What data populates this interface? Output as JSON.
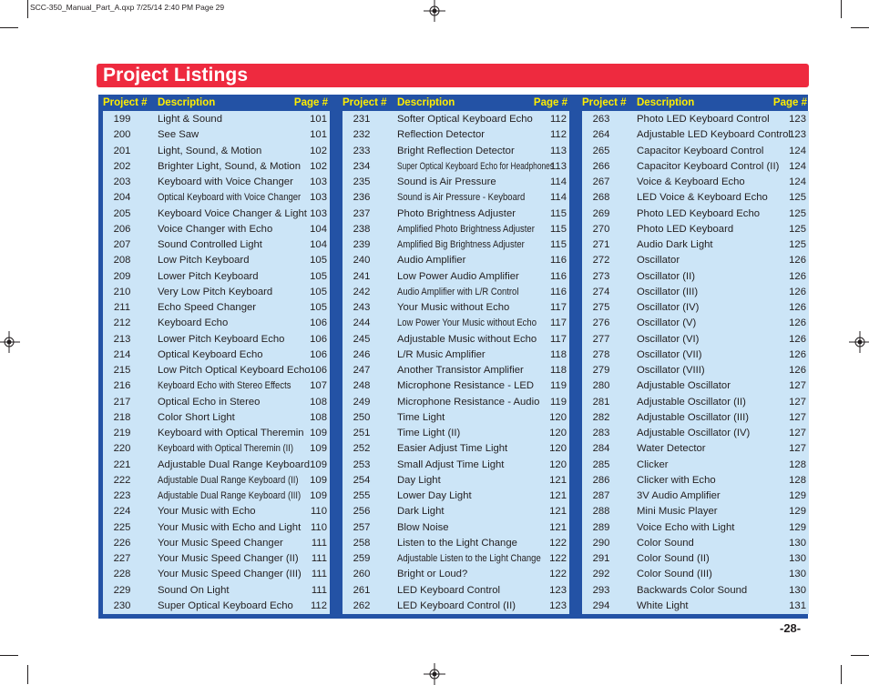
{
  "slug": "SCC-350_Manual_Part_A.qxp  7/25/14  2:40 PM  Page 29",
  "title": "Project Listings",
  "page_number": "-28-",
  "colors": {
    "banner": "#ee2a3f",
    "table_border": "#2352a5",
    "header_text": "#ffee00",
    "row_bg": "#cce5f7"
  },
  "headers": {
    "project": "Project #",
    "description": "Description",
    "page": "Page #"
  },
  "columns": [
    [
      {
        "num": "199",
        "desc": "Light & Sound",
        "page": "101"
      },
      {
        "num": "200",
        "desc": "See Saw",
        "page": "101"
      },
      {
        "num": "201",
        "desc": "Light, Sound, & Motion",
        "page": "102"
      },
      {
        "num": "202",
        "desc": "Brighter Light, Sound, & Motion",
        "page": "102"
      },
      {
        "num": "203",
        "desc": "Keyboard with Voice Changer",
        "page": "103"
      },
      {
        "num": "204",
        "desc": "Optical Keyboard with Voice Changer",
        "page": "103"
      },
      {
        "num": "205",
        "desc": "Keyboard Voice Changer & Light",
        "page": "103"
      },
      {
        "num": "206",
        "desc": "Voice Changer with Echo",
        "page": "104"
      },
      {
        "num": "207",
        "desc": "Sound Controlled Light",
        "page": "104"
      },
      {
        "num": "208",
        "desc": "Low Pitch Keyboard",
        "page": "105"
      },
      {
        "num": "209",
        "desc": "Lower Pitch Keyboard",
        "page": "105"
      },
      {
        "num": "210",
        "desc": "Very Low Pitch Keyboard",
        "page": "105"
      },
      {
        "num": "211",
        "desc": "Echo Speed Changer",
        "page": "105"
      },
      {
        "num": "212",
        "desc": "Keyboard Echo",
        "page": "106"
      },
      {
        "num": "213",
        "desc": "Lower Pitch Keyboard Echo",
        "page": "106"
      },
      {
        "num": "214",
        "desc": "Optical Keyboard Echo",
        "page": "106"
      },
      {
        "num": "215",
        "desc": "Low Pitch Optical Keyboard Echo",
        "page": "106"
      },
      {
        "num": "216",
        "desc": "Keyboard Echo with Stereo Effects",
        "page": "107"
      },
      {
        "num": "217",
        "desc": "Optical Echo in Stereo",
        "page": "108"
      },
      {
        "num": "218",
        "desc": "Color Short Light",
        "page": "108"
      },
      {
        "num": "219",
        "desc": "Keyboard with Optical Theremin",
        "page": "109"
      },
      {
        "num": "220",
        "desc": "Keyboard with Optical Theremin (II)",
        "page": "109"
      },
      {
        "num": "221",
        "desc": "Adjustable Dual Range Keyboard",
        "page": "109"
      },
      {
        "num": "222",
        "desc": "Adjustable Dual Range Keyboard (II)",
        "page": "109"
      },
      {
        "num": "223",
        "desc": "Adjustable Dual Range Keyboard (III)",
        "page": "109"
      },
      {
        "num": "224",
        "desc": "Your Music with Echo",
        "page": "110"
      },
      {
        "num": "225",
        "desc": "Your Music with Echo and Light",
        "page": "110"
      },
      {
        "num": "226",
        "desc": "Your Music Speed Changer",
        "page": "111"
      },
      {
        "num": "227",
        "desc": "Your Music Speed Changer (II)",
        "page": "111"
      },
      {
        "num": "228",
        "desc": "Your Music Speed Changer (III)",
        "page": "111"
      },
      {
        "num": "229",
        "desc": "Sound On Light",
        "page": "111"
      },
      {
        "num": "230",
        "desc": "Super Optical Keyboard Echo",
        "page": "112"
      }
    ],
    [
      {
        "num": "231",
        "desc": "Softer Optical Keyboard Echo",
        "page": "112"
      },
      {
        "num": "232",
        "desc": "Reflection Detector",
        "page": "112"
      },
      {
        "num": "233",
        "desc": "Bright Reflection Detector",
        "page": "113"
      },
      {
        "num": "234",
        "desc": "Super Optical Keyboard Echo for Headphones",
        "page": "113"
      },
      {
        "num": "235",
        "desc": "Sound is Air Pressure",
        "page": "114"
      },
      {
        "num": "236",
        "desc": "Sound is Air Pressure - Keyboard",
        "page": "114"
      },
      {
        "num": "237",
        "desc": "Photo Brightness Adjuster",
        "page": "115"
      },
      {
        "num": "238",
        "desc": "Amplified Photo Brightness Adjuster",
        "page": "115"
      },
      {
        "num": "239",
        "desc": "Amplified Big Brightness Adjuster",
        "page": "115"
      },
      {
        "num": "240",
        "desc": "Audio Amplifier",
        "page": "116"
      },
      {
        "num": "241",
        "desc": "Low Power Audio Amplifier",
        "page": "116"
      },
      {
        "num": "242",
        "desc": "Audio Amplifier with L/R Control",
        "page": "116"
      },
      {
        "num": "243",
        "desc": "Your Music without Echo",
        "page": "117"
      },
      {
        "num": "244",
        "desc": "Low Power Your Music without Echo",
        "page": "117"
      },
      {
        "num": "245",
        "desc": "Adjustable Music without Echo",
        "page": "117"
      },
      {
        "num": "246",
        "desc": "L/R Music Amplifier",
        "page": "118"
      },
      {
        "num": "247",
        "desc": "Another Transistor Amplifier",
        "page": "118"
      },
      {
        "num": "248",
        "desc": "Microphone Resistance - LED",
        "page": "119"
      },
      {
        "num": "249",
        "desc": "Microphone Resistance - Audio",
        "page": "119"
      },
      {
        "num": "250",
        "desc": "Time Light",
        "page": "120"
      },
      {
        "num": "251",
        "desc": "Time Light (II)",
        "page": "120"
      },
      {
        "num": "252",
        "desc": "Easier Adjust Time Light",
        "page": "120"
      },
      {
        "num": "253",
        "desc": "Small Adjust Time Light",
        "page": "120"
      },
      {
        "num": "254",
        "desc": "Day Light",
        "page": "121"
      },
      {
        "num": "255",
        "desc": "Lower Day Light",
        "page": "121"
      },
      {
        "num": "256",
        "desc": "Dark Light",
        "page": "121"
      },
      {
        "num": "257",
        "desc": "Blow Noise",
        "page": "121"
      },
      {
        "num": "258",
        "desc": "Listen to the Light Change",
        "page": "122"
      },
      {
        "num": "259",
        "desc": "Adjustable Listen to the Light Change",
        "page": "122"
      },
      {
        "num": "260",
        "desc": "Bright or Loud?",
        "page": "122"
      },
      {
        "num": "261",
        "desc": "LED Keyboard Control",
        "page": "123"
      },
      {
        "num": "262",
        "desc": "LED Keyboard Control (II)",
        "page": "123"
      }
    ],
    [
      {
        "num": "263",
        "desc": "Photo LED Keyboard Control",
        "page": "123"
      },
      {
        "num": "264",
        "desc": "Adjustable LED Keyboard Control",
        "page": "123"
      },
      {
        "num": "265",
        "desc": "Capacitor Keyboard Control",
        "page": "124"
      },
      {
        "num": "266",
        "desc": "Capacitor Keyboard Control (II)",
        "page": "124"
      },
      {
        "num": "267",
        "desc": "Voice & Keyboard Echo",
        "page": "124"
      },
      {
        "num": "268",
        "desc": "LED Voice & Keyboard Echo",
        "page": "125"
      },
      {
        "num": "269",
        "desc": "Photo LED Keyboard Echo",
        "page": "125"
      },
      {
        "num": "270",
        "desc": "Photo LED Keyboard",
        "page": "125"
      },
      {
        "num": "271",
        "desc": "Audio Dark Light",
        "page": "125"
      },
      {
        "num": "272",
        "desc": "Oscillator",
        "page": "126"
      },
      {
        "num": "273",
        "desc": "Oscillator (II)",
        "page": "126"
      },
      {
        "num": "274",
        "desc": "Oscillator (III)",
        "page": "126"
      },
      {
        "num": "275",
        "desc": "Oscillator (IV)",
        "page": "126"
      },
      {
        "num": "276",
        "desc": "Oscillator (V)",
        "page": "126"
      },
      {
        "num": "277",
        "desc": "Oscillator (VI)",
        "page": "126"
      },
      {
        "num": "278",
        "desc": "Oscillator (VII)",
        "page": "126"
      },
      {
        "num": "279",
        "desc": "Oscillator (VIII)",
        "page": "126"
      },
      {
        "num": "280",
        "desc": "Adjustable Oscillator",
        "page": "127"
      },
      {
        "num": "281",
        "desc": "Adjustable Oscillator (II)",
        "page": "127"
      },
      {
        "num": "282",
        "desc": "Adjustable Oscillator (III)",
        "page": "127"
      },
      {
        "num": "283",
        "desc": "Adjustable Oscillator (IV)",
        "page": "127"
      },
      {
        "num": "284",
        "desc": "Water Detector",
        "page": "127"
      },
      {
        "num": "285",
        "desc": "Clicker",
        "page": "128"
      },
      {
        "num": "286",
        "desc": "Clicker with Echo",
        "page": "128"
      },
      {
        "num": "287",
        "desc": "3V Audio Amplifier",
        "page": "129"
      },
      {
        "num": "288",
        "desc": "Mini Music Player",
        "page": "129"
      },
      {
        "num": "289",
        "desc": "Voice Echo with Light",
        "page": "129"
      },
      {
        "num": "290",
        "desc": "Color Sound",
        "page": "130"
      },
      {
        "num": "291",
        "desc": "Color Sound (II)",
        "page": "130"
      },
      {
        "num": "292",
        "desc": "Color Sound (III)",
        "page": "130"
      },
      {
        "num": "293",
        "desc": "Backwards Color Sound",
        "page": "130"
      },
      {
        "num": "294",
        "desc": "White Light",
        "page": "131"
      }
    ]
  ]
}
